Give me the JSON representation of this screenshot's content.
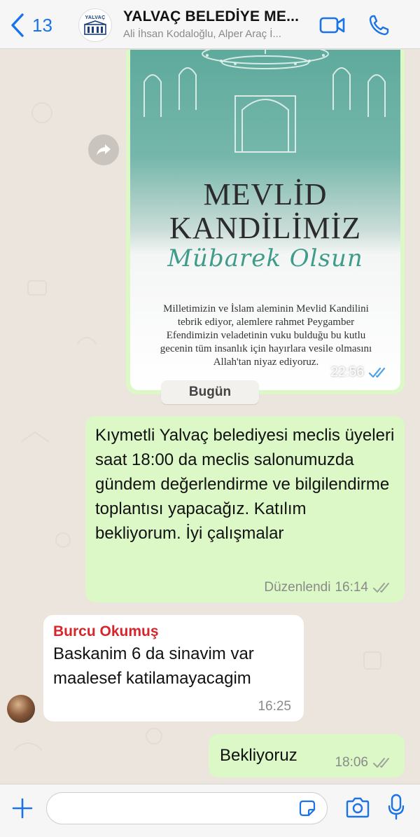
{
  "header": {
    "back_count": "13",
    "title": "YALVAÇ BELEDİYE ME...",
    "subtitle": "Ali İhsan Kodaloğlu, Alper Araç İ...",
    "avatar_text": "YALVAÇ",
    "icons": [
      "back-chevron-icon",
      "video-call-icon",
      "phone-call-icon"
    ]
  },
  "messages": {
    "image_message": {
      "poster_title_line1": "MEVLİD",
      "poster_title_line2": "KANDİLİMİZ",
      "poster_script": "Mübarek Olsun",
      "poster_body": "Milletimizin ve İslam aleminin Mevlid Kandilini tebrik ediyor, alemlere rahmet Peygamber Efendimizin veladetinin vuku bulduğu bu kutlu gecenin tüm insanlık için hayırlara vesile olmasını Allah'tan niyaz ediyoruz.",
      "time": "22:56",
      "status": "read"
    },
    "date_separator": "Bugün",
    "msg1": {
      "text": "Kıymetli Yalvaç belediyesi meclis üyeleri saat 18:00 da meclis salonumuzda gündem değerlendirme ve bilgilendirme toplantısı yapacağız. Katılım bekliyorum. İyi çalışmalar",
      "edited_label": "Düzenlendi",
      "time": "16:14",
      "status": "delivered"
    },
    "msg2": {
      "sender": "Burcu Okumuş",
      "text": "Baskanim 6 da sinavim var maalesef katilamayacagim",
      "time": "16:25"
    },
    "msg3": {
      "text": "Bekliyoruz",
      "time": "18:06",
      "status": "delivered"
    }
  },
  "composer": {
    "value": "",
    "placeholder": "",
    "icons": [
      "plus-icon",
      "sticker-icon",
      "camera-icon",
      "microphone-icon"
    ]
  },
  "colors": {
    "accent": "#1a73e8",
    "outgoing_bubble": "#dcf8c6",
    "incoming_bubble": "#ffffff",
    "chat_background": "#ece5dd",
    "sender_name": "#d7262b",
    "read_ticks": "#4fa3e6"
  }
}
